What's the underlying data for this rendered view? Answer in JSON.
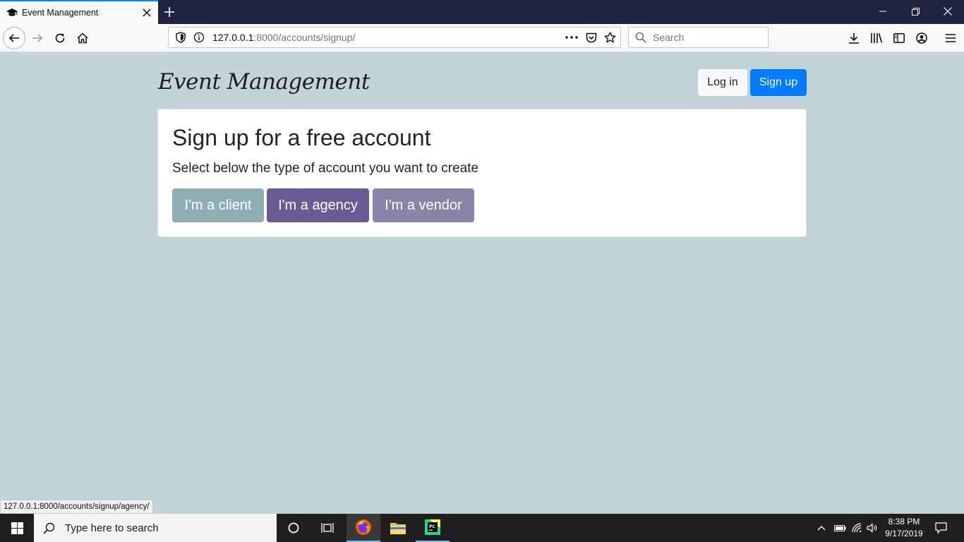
{
  "browser": {
    "tab_title": "Event Management",
    "url_host": "127.0.0.1",
    "url_rest": ":8000/accounts/signup/",
    "search_placeholder": "Search",
    "status_url": "127.0.0.1:8000/accounts/signup/agency/"
  },
  "page": {
    "brand": "Event Management",
    "nav": {
      "login_label": "Log in",
      "signup_label": "Sign up"
    },
    "card": {
      "title": "Sign up for a free account",
      "subtitle": "Select below the type of account you want to create",
      "options": [
        {
          "label": "I'm a client",
          "color": "#8fadb5"
        },
        {
          "label": "I'm a agency",
          "color": "#6b5b93"
        },
        {
          "label": "I'm a vendor",
          "color": "#8a82a7"
        }
      ]
    },
    "colors": {
      "background": "#c2d4d9",
      "primary": "#007bff"
    }
  },
  "taskbar": {
    "search_placeholder": "Type here to search",
    "time": "8:38 PM",
    "date": "9/17/2019"
  }
}
